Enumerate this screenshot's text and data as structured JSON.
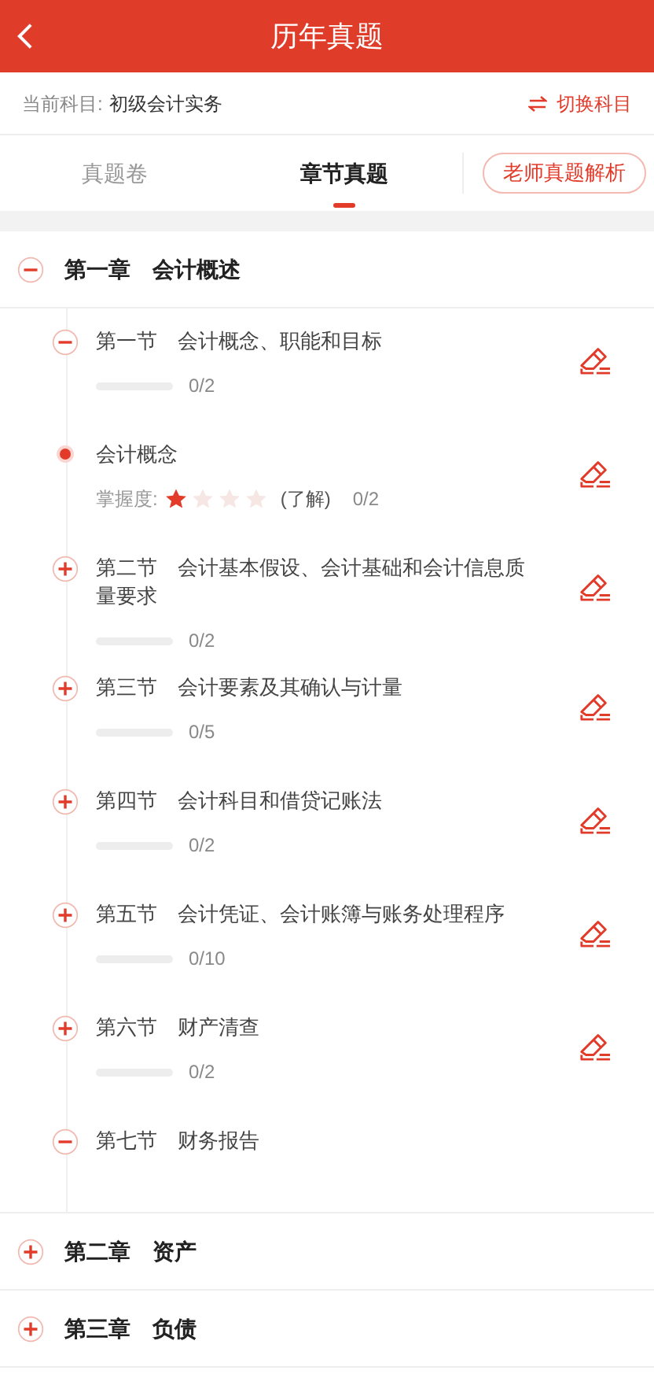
{
  "header": {
    "title": "历年真题"
  },
  "subject_bar": {
    "label": "当前科目:",
    "subject": "初级会计实务",
    "switch": "切换科目"
  },
  "tabs": [
    {
      "label": "真题卷",
      "selected": false
    },
    {
      "label": "章节真题",
      "selected": true
    }
  ],
  "teacher_button": "老师真题解析",
  "chapters": [
    {
      "title": "第一章　会计概述",
      "expanded": true,
      "children": [
        {
          "kind": "section",
          "title": "第一节　会计概念、职能和目标",
          "expanded": true,
          "level": 0,
          "count": "0/2"
        },
        {
          "kind": "point",
          "title": "会计概念",
          "mastery_label": "掌握度:",
          "stars": 1,
          "mastery": "(了解)",
          "count": "0/2"
        },
        {
          "kind": "section",
          "title": "第二节　会计基本假设、会计基础和会计信息质量要求",
          "expanded": false,
          "level": 0,
          "count": "0/2"
        },
        {
          "kind": "section",
          "title": "第三节　会计要素及其确认与计量",
          "expanded": false,
          "level": 0,
          "count": "0/5"
        },
        {
          "kind": "section",
          "title": "第四节　会计科目和借贷记账法",
          "expanded": false,
          "level": 0,
          "count": "0/2"
        },
        {
          "kind": "section",
          "title": "第五节　会计凭证、会计账簿与账务处理程序",
          "expanded": false,
          "level": 0,
          "count": "0/10"
        },
        {
          "kind": "section",
          "title": "第六节　财产清查",
          "expanded": false,
          "level": 0,
          "count": "0/2"
        },
        {
          "kind": "section",
          "title": "第七节　财务报告",
          "expanded": true
        }
      ]
    },
    {
      "title": "第二章　资产",
      "expanded": false
    },
    {
      "title": "第三章　负债",
      "expanded": false
    }
  ]
}
